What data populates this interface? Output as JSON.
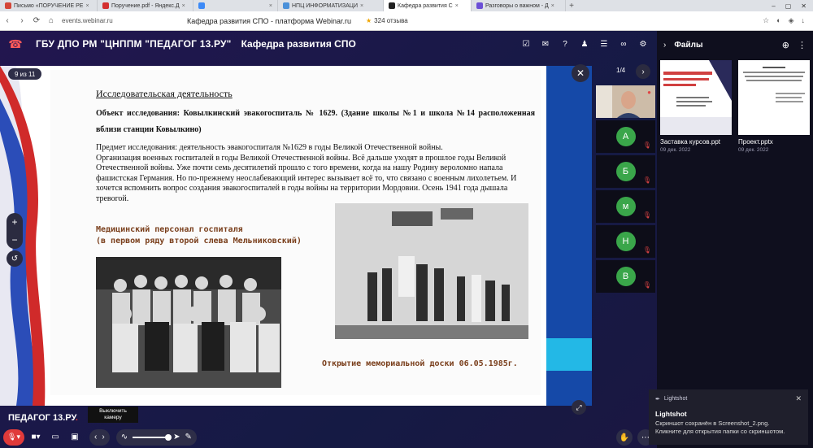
{
  "browser": {
    "tabs": [
      {
        "label": "Письмо «ПОРУЧЕНИЕ РЕ",
        "color": "#d44638"
      },
      {
        "label": "Поручение.pdf - Яндекс.Д",
        "color": "#d32f2f"
      },
      {
        "label": "",
        "color": "#3d8af7"
      },
      {
        "label": "НПЦ ИНФОРМАТИЗАЦИ",
        "color": "#4a90d9"
      },
      {
        "label": "Кафедра развития С",
        "color": "#222222",
        "active": true
      },
      {
        "label": "Разговоры о важном - Д",
        "color": "#6b4fd6"
      }
    ],
    "url": "events.webinar.ru",
    "page_title": "Кафедра развития СПО - платформа Webinar.ru",
    "reviews": "324 отзыва"
  },
  "header": {
    "org_name": "ГБУ ДПО РМ \"ЦНППМ \"ПЕДАГОГ 13.РУ\"",
    "event_name": "Кафедра развития СПО"
  },
  "presentation": {
    "counter": "9 из 11",
    "slide": {
      "title": "Исследовательская деятельность",
      "object": "Объект исследования: Ковылкинский эвакогоспиталь № 1629.  (Здание школы №1 и школа №14 расположенная вблизи станции Ковылкино)",
      "body_lines": [
        "Предмет исследования: деятельность эвакогоспиталя №1629 в годы Великой Отечественной войны.",
        "Организация военных госпиталей в годы Великой Отечественной войны. Всё дальше уходят в прошлое годы Великой Отечественной войны. Уже почти семь десятилетий прошло с того времени, когда на нашу Родину вероломно напала фашистская Германия. Но по-прежнему неослабевающий интерес вызывает всё то, что связано с военным лихолетьем. И хочется вспомнить вопрос создания эвакогоспиталей в годы войны на территории Мордовии. Осень 1941 года дышала тревогой."
      ],
      "caption1_line1": "Медицинский персонал госпиталя",
      "caption1_line2": "(в первом ряду второй слева Мельниковский)",
      "caption2": "Открытие мемориальной доски 06.05.1985г."
    }
  },
  "participants": {
    "page": "1/4",
    "list": [
      {
        "initial": "",
        "camera": true
      },
      {
        "initial": "А"
      },
      {
        "initial": "Б"
      },
      {
        "initial": "м"
      },
      {
        "initial": "Н"
      },
      {
        "initial": "В"
      }
    ]
  },
  "footer": {
    "brand": "ПЕДАГОГ 13.РУ",
    "camera_tooltip_line1": "Выключить",
    "camera_tooltip_line2": "камеру"
  },
  "files": {
    "title": "Файлы",
    "items": [
      {
        "name": "Заставка курсов.ppt",
        "date": "09 дек. 2022"
      },
      {
        "name": "Проект.pptx",
        "date": "09 дек. 2022"
      }
    ]
  },
  "toast": {
    "header": "Lightshot",
    "app": "Lightshot",
    "message_line1": "Скриншот сохранён в Screenshot_2.png.",
    "message_line2": "Кликните для открытия папки со скриншотом."
  }
}
